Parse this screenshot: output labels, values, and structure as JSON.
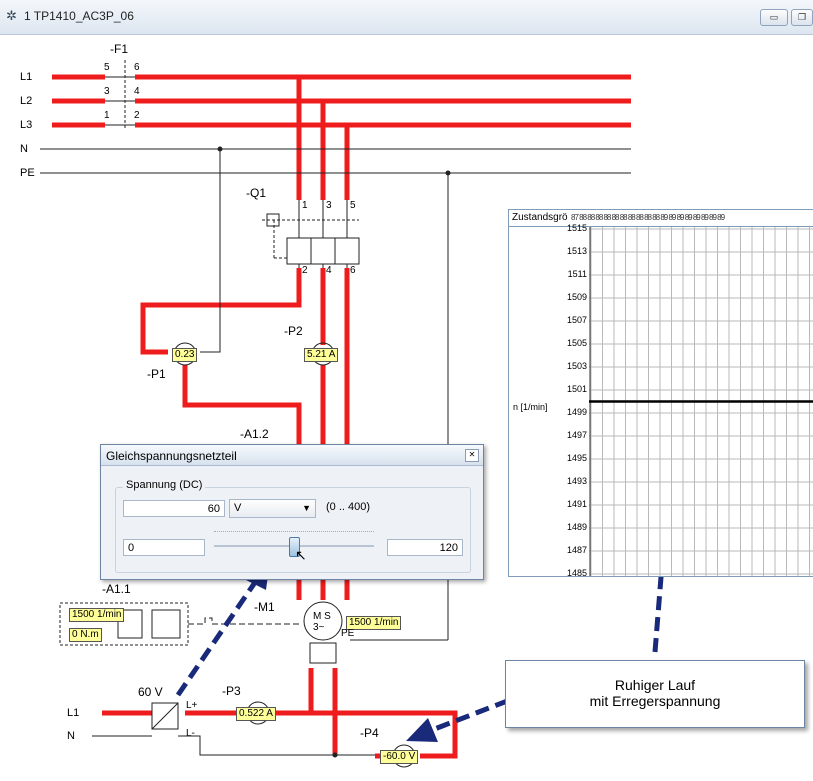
{
  "window": {
    "title": "1  TP1410_AC3P_06",
    "minimize_icon": "minimize-icon",
    "maximize_icon": "maximize-icon"
  },
  "schematic": {
    "fuse_label": "-F1",
    "lines": [
      "L1",
      "L2",
      "L3",
      "N",
      "PE"
    ],
    "fuse_terminals": {
      "t5": "5",
      "t6": "6",
      "t3": "3",
      "t4": "4",
      "t1": "1",
      "t2": "2"
    },
    "breaker_label": "-Q1",
    "breaker_terminals": {
      "top1": "1",
      "top3": "3",
      "top5": "5",
      "bot2": "2",
      "bot4": "4",
      "bot6": "6"
    },
    "meter_p1_label": "-P1",
    "meter_p1_value": "0.23",
    "meter_p2_label": "-P2",
    "meter_p2_value": "5.21 A",
    "a12_label": "-A1.2",
    "a11_label": "-A1.1",
    "a11_speed": "1500 1/min",
    "a11_torque": "0 N.m",
    "motor_label": "-M1",
    "motor_symbol": "M S",
    "motor_phase": "3~",
    "motor_speed": "1500 1/min",
    "motor_pe": "PE",
    "dc_voltage_label": "60 V",
    "dc_lplus": "L+",
    "dc_lminus": "L-",
    "dc_l1": "L1",
    "dc_n": "N",
    "meter_p3_label": "-P3",
    "meter_p3_value": "0.522 A",
    "meter_p4_label": "-P4",
    "meter_p4_value": "-60.0 V"
  },
  "plot": {
    "header": "Zustandsgrö",
    "header_ticks": "87 88 88 88 88 88 88 88 88 88 88 89 89 89 89 89 89 89 89",
    "ylabel": "n [1/min]",
    "chart_data": {
      "type": "line",
      "ylabel": "n [1/min]",
      "ylim": [
        1485,
        1515
      ],
      "yticks": [
        1515,
        1513,
        1511,
        1509,
        1507,
        1505,
        1503,
        1501,
        1499,
        1497,
        1495,
        1493,
        1491,
        1489,
        1487,
        1485
      ],
      "series": [
        {
          "values": [
            1500,
            1500
          ]
        }
      ],
      "grid": true
    }
  },
  "dialog": {
    "title": "Gleichspannungsnetzteil",
    "group": "Spannung (DC)",
    "value": "60",
    "unit": "V",
    "range": "(0 .. 400)",
    "slider_min": "0",
    "slider_max": "120",
    "slider_fraction": 0.5
  },
  "callout": {
    "line1": "Ruhiger Lauf",
    "line2": "mit Erregerspannung"
  },
  "colors": {
    "power": "#ee1c1c",
    "arrow": "#1a2a7a",
    "meter": "#ffff99"
  }
}
